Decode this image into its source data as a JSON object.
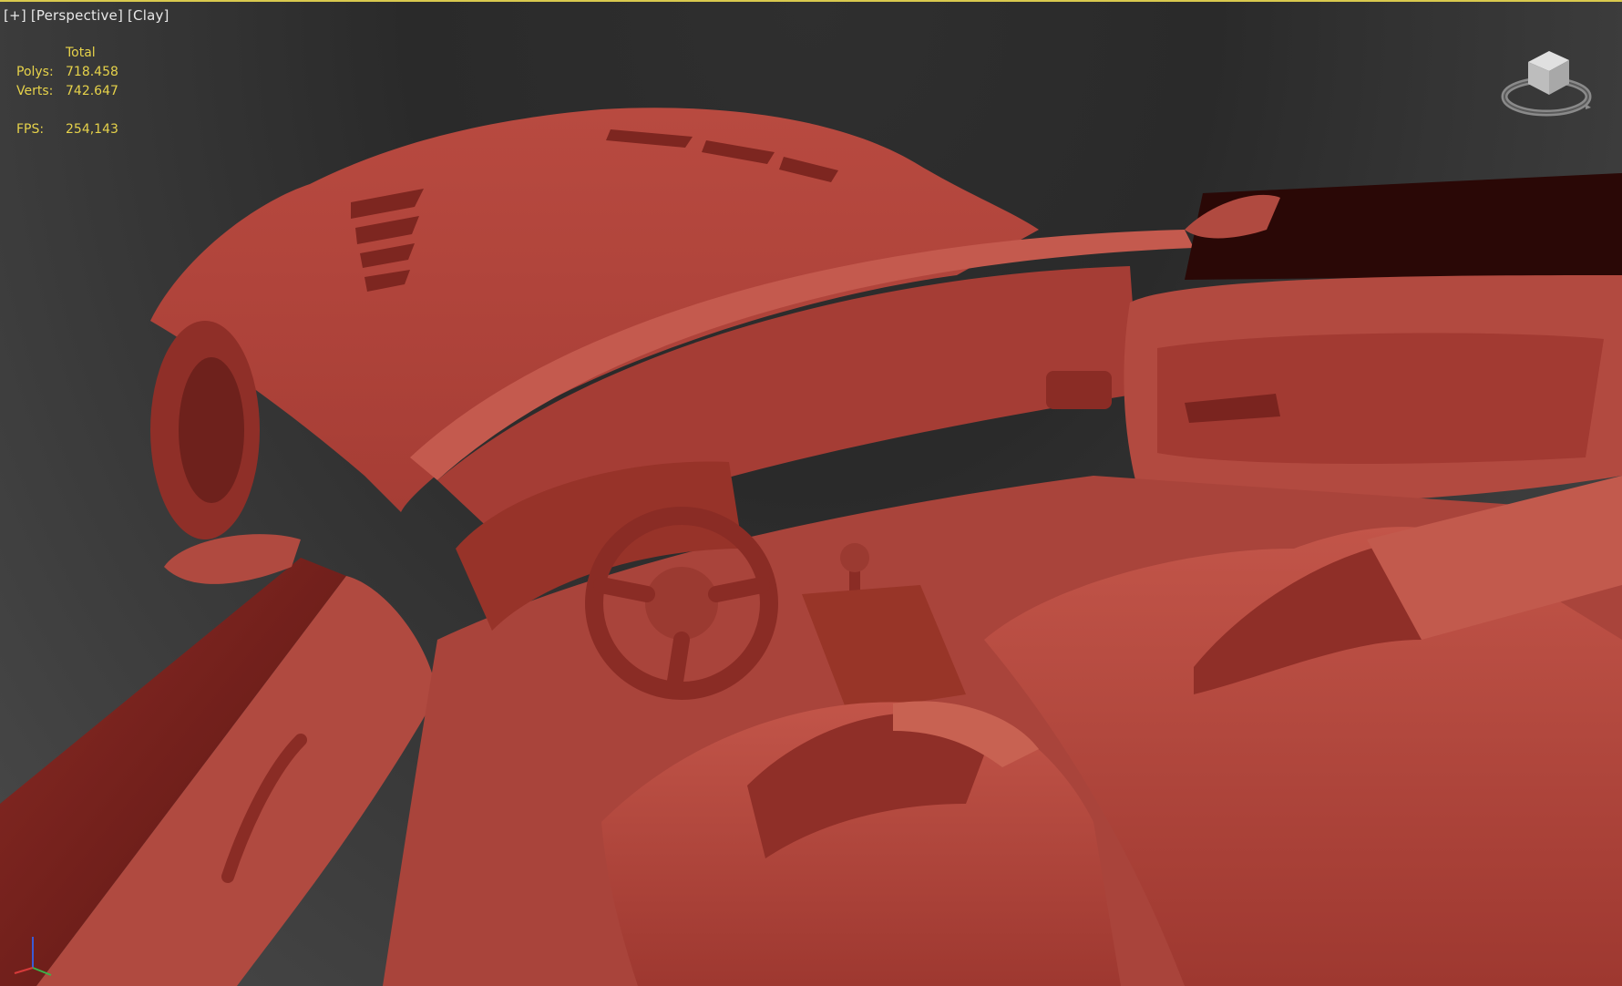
{
  "viewport": {
    "label_plus": "[+]",
    "label_view": "[Perspective]",
    "label_shading": "[Clay]"
  },
  "stats": {
    "header": "Total",
    "polys_label": "Polys:",
    "polys_value": "718.458",
    "verts_label": "Verts:",
    "verts_value": "742.647",
    "fps_label": "FPS:",
    "fps_value": "254,143"
  },
  "colors": {
    "stats_text": "#e6d24a",
    "active_border": "#d9c94e",
    "clay": "#b8453c"
  },
  "icons": {
    "viewcube": "viewcube-icon",
    "axis": "axis-tripod-icon"
  }
}
